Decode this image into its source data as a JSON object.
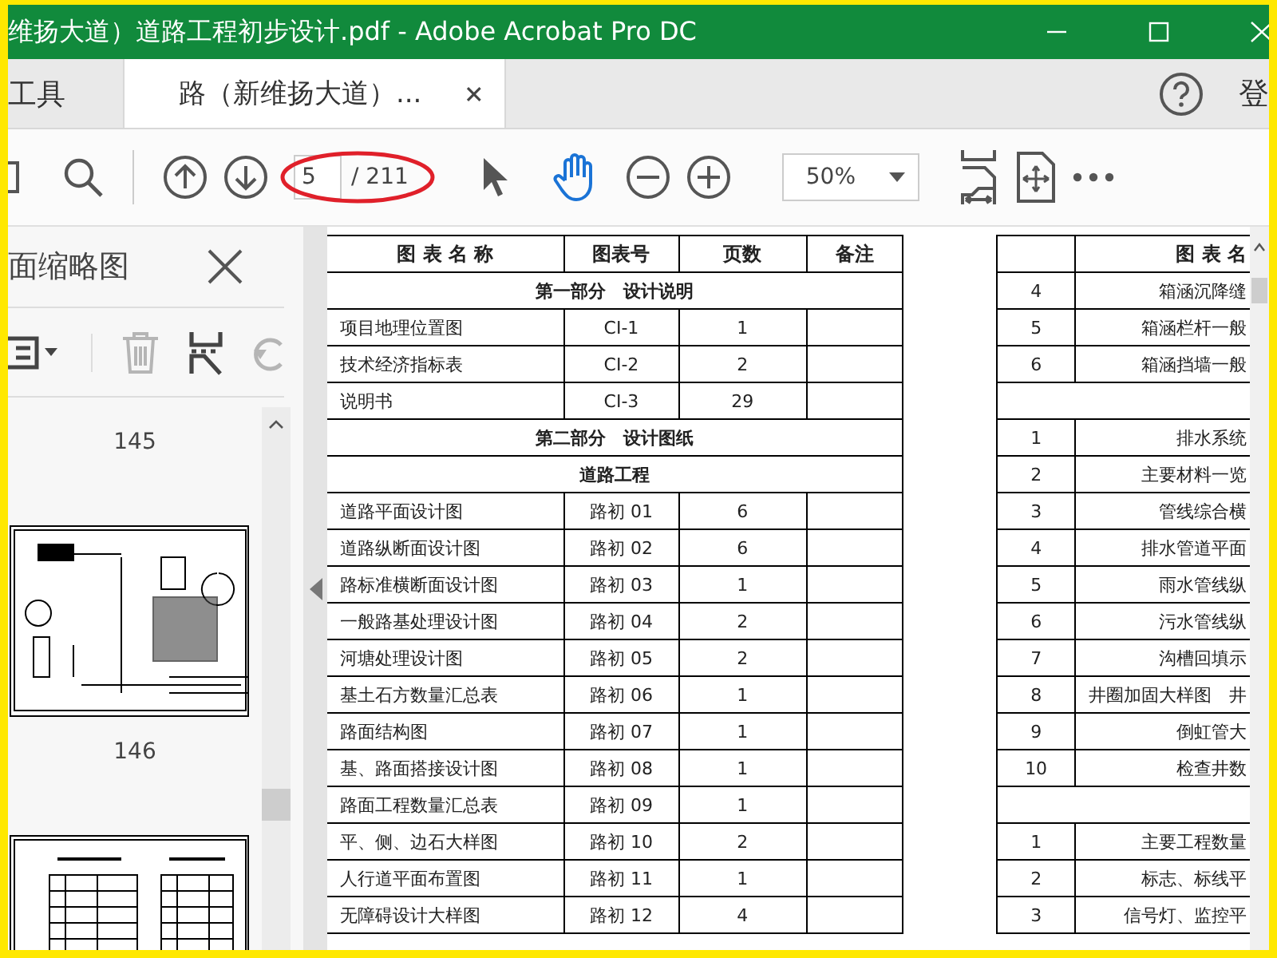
{
  "window": {
    "title": "维扬大道）道路工程初步设计.pdf - Adobe Acrobat Pro DC"
  },
  "tabs": [
    {
      "label": "工具",
      "selected": false,
      "closable": false
    },
    {
      "label": "路（新维扬大道）...",
      "selected": true,
      "closable": true
    }
  ],
  "account": {
    "label": "登"
  },
  "toolbar": {
    "page_value": "5",
    "page_total": "/ 211",
    "zoom": "50%",
    "tools": [
      {
        "kind": "select",
        "selected": false
      },
      {
        "kind": "hand",
        "selected": true
      }
    ]
  },
  "sidebar": {
    "title": "面缩略图",
    "tools": [
      {
        "kind": "options",
        "disabled": false
      },
      {
        "kind": "delete",
        "disabled": true
      },
      {
        "kind": "extract",
        "disabled": false
      },
      {
        "kind": "rotate",
        "disabled": true
      }
    ],
    "pages": [
      {
        "label": "145"
      },
      {
        "label": "146"
      }
    ]
  },
  "table_1": {
    "columns": [
      "图 表 名 称",
      "图表号",
      "页数",
      "备注"
    ],
    "rows": [
      {
        "kind": "section",
        "text": "第一部分　设计说明"
      },
      {
        "kind": "item",
        "cells": [
          "项目地理位置图",
          "CI-1",
          "1"
        ]
      },
      {
        "kind": "item",
        "cells": [
          "技术经济指标表",
          "CI-2",
          "2"
        ]
      },
      {
        "kind": "item",
        "cells": [
          "说明书",
          "CI-3",
          "29"
        ]
      },
      {
        "kind": "section",
        "text": "第二部分　设计图纸"
      },
      {
        "kind": "section",
        "text": "道路工程"
      },
      {
        "kind": "item",
        "cells": [
          "道路平面设计图",
          "路初 01",
          "6"
        ]
      },
      {
        "kind": "item",
        "cells": [
          "道路纵断面设计图",
          "路初 02",
          "6"
        ]
      },
      {
        "kind": "item",
        "cells": [
          "路标准横断面设计图",
          "路初 03",
          "1"
        ]
      },
      {
        "kind": "item",
        "cells": [
          "一般路基处理设计图",
          "路初 04",
          "2"
        ]
      },
      {
        "kind": "item",
        "cells": [
          "河塘处理设计图",
          "路初 05",
          "2"
        ]
      },
      {
        "kind": "item",
        "cells": [
          "基土石方数量汇总表",
          "路初 06",
          "1"
        ]
      },
      {
        "kind": "item",
        "cells": [
          "路面结构图",
          "路初 07",
          "1"
        ]
      },
      {
        "kind": "item",
        "cells": [
          "基、路面搭接设计图",
          "路初 08",
          "1"
        ]
      },
      {
        "kind": "item",
        "cells": [
          "路面工程数量汇总表",
          "路初 09",
          "1"
        ]
      },
      {
        "kind": "item",
        "cells": [
          "平、侧、边石大样图",
          "路初 10",
          "2"
        ]
      },
      {
        "kind": "item",
        "cells": [
          "人行道平面布置图",
          "路初 11",
          "1"
        ]
      },
      {
        "kind": "item",
        "cells": [
          "无障碍设计大样图",
          "路初 12",
          "4"
        ]
      }
    ]
  },
  "table_2": {
    "column_2": "图 表 名",
    "rows": [
      {
        "kind": "item",
        "cells": [
          "4",
          "箱涵沉降缝"
        ]
      },
      {
        "kind": "item",
        "cells": [
          "5",
          "箱涵栏杆一般"
        ]
      },
      {
        "kind": "item",
        "cells": [
          "6",
          "箱涵挡墙一般"
        ]
      },
      {
        "kind": "blank"
      },
      {
        "kind": "item",
        "cells": [
          "1",
          "排水系统"
        ]
      },
      {
        "kind": "item",
        "cells": [
          "2",
          "主要材料一览"
        ]
      },
      {
        "kind": "item",
        "cells": [
          "3",
          "管线综合横"
        ]
      },
      {
        "kind": "item",
        "cells": [
          "4",
          "排水管道平面"
        ]
      },
      {
        "kind": "item",
        "cells": [
          "5",
          "雨水管线纵"
        ]
      },
      {
        "kind": "item",
        "cells": [
          "6",
          "污水管线纵"
        ]
      },
      {
        "kind": "item",
        "cells": [
          "7",
          "沟槽回填示"
        ]
      },
      {
        "kind": "item",
        "cells": [
          "8",
          "井圈加固大样图　井"
        ]
      },
      {
        "kind": "item",
        "cells": [
          "9",
          "倒虹管大"
        ]
      },
      {
        "kind": "item",
        "cells": [
          "10",
          "检查井数"
        ]
      },
      {
        "kind": "blank"
      },
      {
        "kind": "item",
        "cells": [
          "1",
          "主要工程数量"
        ]
      },
      {
        "kind": "item",
        "cells": [
          "2",
          "标志、标线平"
        ]
      },
      {
        "kind": "item",
        "cells": [
          "3",
          "信号灯、监控平"
        ]
      }
    ]
  }
}
